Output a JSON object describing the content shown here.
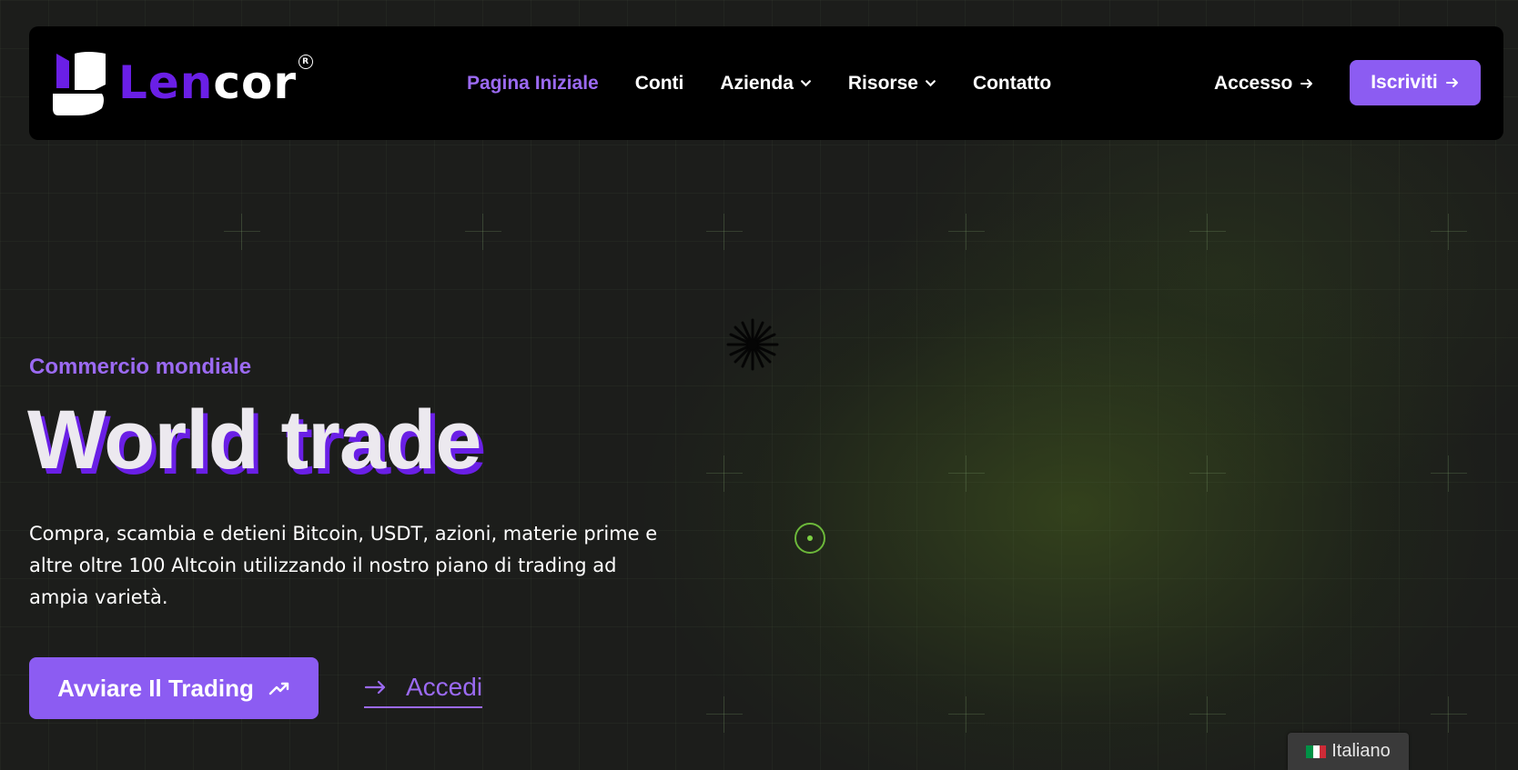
{
  "header": {
    "brand": {
      "name_part1": "Len",
      "name_part2": "cor",
      "registered": "R"
    },
    "nav": [
      {
        "label": "Pagina Iniziale",
        "active": true,
        "has_dropdown": false
      },
      {
        "label": "Conti",
        "active": false,
        "has_dropdown": false
      },
      {
        "label": "Azienda",
        "active": false,
        "has_dropdown": true
      },
      {
        "label": "Risorse",
        "active": false,
        "has_dropdown": true
      },
      {
        "label": "Contatto",
        "active": false,
        "has_dropdown": false
      }
    ],
    "login_label": "Accesso",
    "signup_label": "Iscriviti"
  },
  "hero": {
    "eyebrow": "Commercio mondiale",
    "title": "World trade",
    "description": "Compra, scambia e detieni Bitcoin, USDT, azioni, materie prime e altre oltre 100 Altcoin utilizzando il nostro piano di trading ad ampia varietà.",
    "primary_cta": "Avviare Il Trading",
    "secondary_cta": "Accedi"
  },
  "language_selector": {
    "label": "Italiano",
    "flag": "italy-flag"
  },
  "colors": {
    "accent": "#8c5cf2",
    "accent_text": "#9b6af2",
    "brand_purple": "#6a1fe6",
    "background": "#1c1d1b",
    "navbar": "#000000",
    "dot_green": "#6cb83a"
  }
}
